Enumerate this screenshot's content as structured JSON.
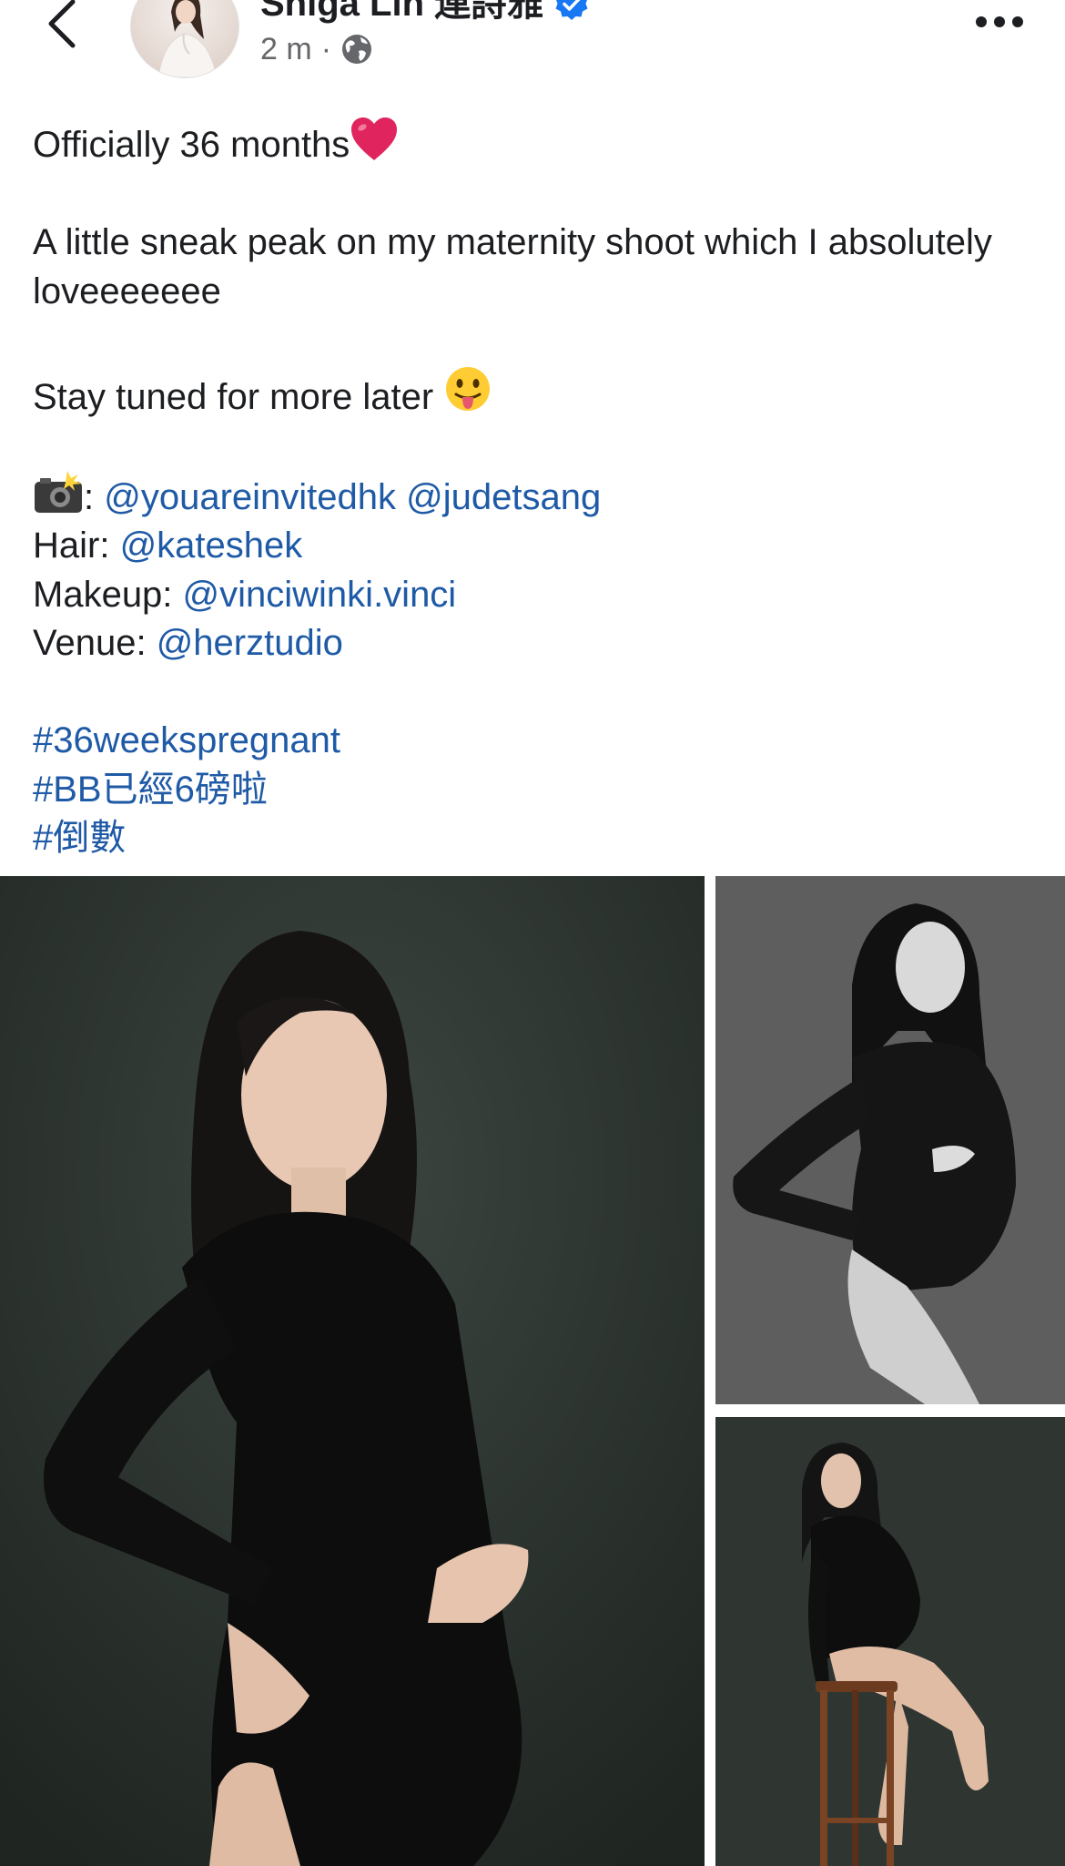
{
  "header": {
    "author_name": "Shiga Lin 連詩雅",
    "post_time": "2 m",
    "meta_separator": "·",
    "icons": {
      "back": "chevron-left-icon",
      "verified": "verified-badge-icon",
      "privacy": "globe-icon",
      "more": "more-horizontal-icon"
    }
  },
  "post": {
    "line1": "Officially 36 months",
    "line2": "A little sneak peak on my maternity shoot which I absolutely loveeeeeee",
    "line3": "Stay tuned for more later ",
    "credits": {
      "photo_sep": ": ",
      "photo_handle1": "@youareinvitedhk",
      "photo_handle2": "@judetsang",
      "hair_label": "Hair: ",
      "hair_handle": "@kateshek",
      "makeup_label": "Makeup: ",
      "makeup_handle": "@vinciwinki.vinci",
      "venue_label": "Venue: ",
      "venue_handle": "@herztudio"
    },
    "hashtags": [
      "#36weekspregnant",
      "#BB已經6磅啦",
      "#倒數"
    ]
  },
  "colors": {
    "link": "#1f5aa6",
    "verified": "#1877f2",
    "text": "#1c1e21",
    "muted": "#65676b"
  }
}
